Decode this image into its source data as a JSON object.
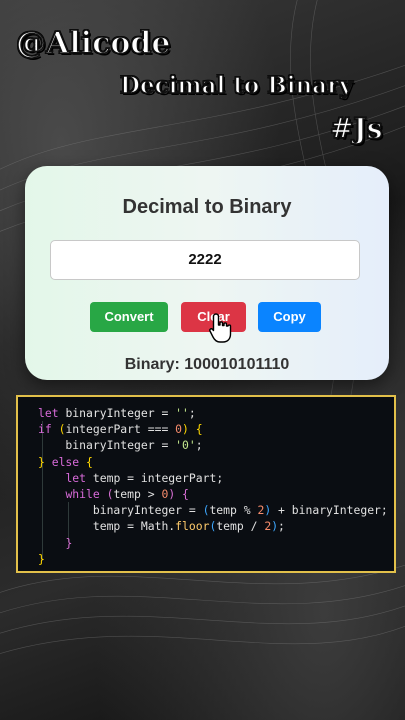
{
  "overlay": {
    "handle": "@Alicode",
    "title": "Decimal to Binary",
    "tag": "#Js"
  },
  "app": {
    "heading": "Decimal to Binary",
    "input_value": "2222",
    "buttons": {
      "convert": "Convert",
      "clear": "Clear",
      "copy": "Copy"
    },
    "result_label": "Binary:",
    "result_value": "100010101110"
  },
  "code": {
    "lines": [
      "let binaryInteger = '';",
      "if (integerPart === 0) {",
      "    binaryInteger = '0';",
      "} else {",
      "    let temp = integerPart;",
      "    while (temp > 0) {",
      "        binaryInteger = (temp % 2) + binaryInteger;",
      "        temp = Math.floor(temp / 2);",
      "    }",
      "}"
    ]
  },
  "colors": {
    "convert": "#28a745",
    "clear": "#dc3545",
    "copy": "#0a84ff",
    "code_border": "#e2c04a"
  }
}
